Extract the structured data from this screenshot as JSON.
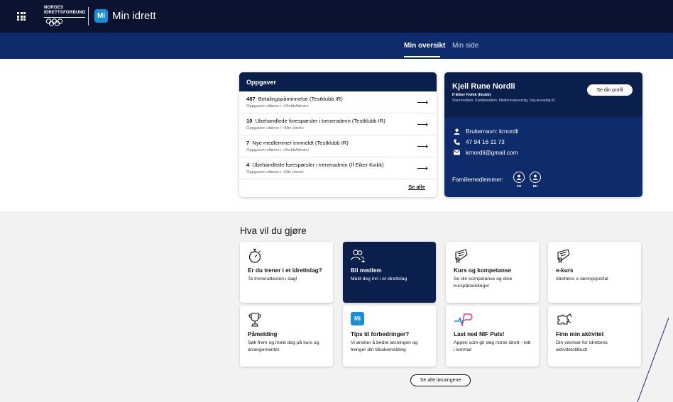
{
  "header": {
    "org_text_line1": "NORGES",
    "org_text_line2": "IDRETTSFORBUND",
    "badge": "Mi",
    "app_title": "Min idrett"
  },
  "subnav": {
    "tabs": [
      {
        "label": "Min oversikt",
        "active": true
      },
      {
        "label": "Min side",
        "active": false
      }
    ]
  },
  "tasks": {
    "heading": "Oppgaver",
    "items": [
      {
        "count": "487",
        "title": "Betalingspåminnelse (Testklubb IR)",
        "sub": "Oppgaven utføres i «KlubbAdmin»"
      },
      {
        "count": "10",
        "title": "Ubehandlede forespørsler i treneradmin (Testklubb IR)",
        "sub": "Oppgaven utføres i «Min idrett»"
      },
      {
        "count": "7",
        "title": "Nye medlemmer innmeldt (Testklubb IR)",
        "sub": "Oppgaven utføres i «KlubbAdmin»"
      },
      {
        "count": "4",
        "title": "Ubehandlede forespørsler i treneradmin (If Eiker Kvikk)",
        "sub": "Oppgaven utføres i «Min idrett»"
      }
    ],
    "see_all": "Se alle"
  },
  "profile": {
    "name": "Kjell Rune Nordli",
    "club": "If Eiker Kvikk (klubb)",
    "roles": "Styremedlem, Klubbmedlem, Medlemsansvarlig, Org.ansvarlig KL",
    "profile_button": "Se din profil",
    "username": "Brukernavn: krnordli",
    "phone": "47 94 16 11 73",
    "email": "krnordli@gmail.com",
    "family_label": "Familiemedlemmer:",
    "family": [
      {
        "initials": "KN"
      },
      {
        "initials": "BH"
      }
    ]
  },
  "solutions": {
    "heading": "Hva vil du gjøre",
    "tiles": [
      {
        "icon": "stopwatch-icon",
        "title": "Er du trener i et idrettslag?",
        "desc": "Ta trenerattesten i dag!",
        "dark": false
      },
      {
        "icon": "add-user-icon",
        "title": "Bli medlem",
        "desc": "Meld deg inn i et idrettslag",
        "dark": true
      },
      {
        "icon": "diploma-icon",
        "title": "Kurs og kompetanse",
        "desc": "Se din kompetanse og dine kurspåmeldinger",
        "dark": false
      },
      {
        "icon": "diploma-icon",
        "title": "e-kurs",
        "desc": "Idrettens e-læringsportal",
        "dark": false
      },
      {
        "icon": "trophy-icon",
        "title": "Påmelding",
        "desc": "Søk frem og meld deg på kurs og arrangementer",
        "dark": false
      },
      {
        "icon": "mi-logo-icon",
        "title": "Tips til forbedringer?",
        "desc": "Vi ønsker å bedre løsningen og trenger din tilbakemelding",
        "dark": false,
        "badge": "Mi"
      },
      {
        "icon": "nif-puls-icon",
        "title": "Last ned NIF Puls!",
        "desc": "Appen som gir deg norsk idrett - rett i lomma!",
        "dark": false
      },
      {
        "icon": "puzzle-icon",
        "title": "Finn min aktivitet",
        "desc": "Din veiviser for idrettens aktivitetstilbud!",
        "dark": false
      }
    ],
    "see_all": "Se alle løsningene"
  },
  "colors": {
    "topbar": "#0b1330",
    "subnav": "#0e2c6b",
    "card_dark": "#0b1f4d",
    "accent": "#1a8fd6"
  }
}
